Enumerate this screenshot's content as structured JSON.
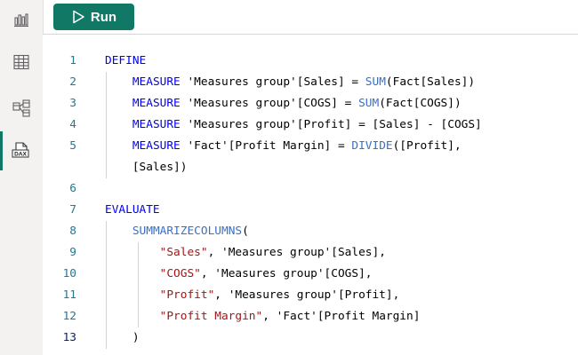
{
  "toolbar": {
    "run_label": "Run"
  },
  "sidebar": {
    "items": [
      {
        "name": "report-view",
        "icon": "bar-chart-icon",
        "active": false
      },
      {
        "name": "table-view",
        "icon": "table-icon",
        "active": false
      },
      {
        "name": "model-view",
        "icon": "model-icon",
        "active": false
      },
      {
        "name": "dax-query-view",
        "icon": "dax-icon",
        "icon_text": "DAX",
        "active": true
      }
    ]
  },
  "colors": {
    "accent": "#117865",
    "keyword": "#0000ff",
    "function": "#3a6fc4",
    "string": "#a31515",
    "line_number": "#237893",
    "sidebar_bg": "#f3f2f1"
  },
  "editor": {
    "current_line": "13",
    "lines": [
      {
        "num": "1",
        "tokens": [
          {
            "t": "DEFINE",
            "c": "kw"
          }
        ]
      },
      {
        "num": "2",
        "tokens": [
          {
            "t": "    ",
            "c": "op"
          },
          {
            "t": "MEASURE",
            "c": "kw"
          },
          {
            "t": " 'Measures group'[Sales] = ",
            "c": "op"
          },
          {
            "t": "SUM",
            "c": "fn"
          },
          {
            "t": "(Fact[Sales])",
            "c": "op"
          }
        ]
      },
      {
        "num": "3",
        "tokens": [
          {
            "t": "    ",
            "c": "op"
          },
          {
            "t": "MEASURE",
            "c": "kw"
          },
          {
            "t": " 'Measures group'[COGS] = ",
            "c": "op"
          },
          {
            "t": "SUM",
            "c": "fn"
          },
          {
            "t": "(Fact[COGS])",
            "c": "op"
          }
        ]
      },
      {
        "num": "4",
        "tokens": [
          {
            "t": "    ",
            "c": "op"
          },
          {
            "t": "MEASURE",
            "c": "kw"
          },
          {
            "t": " 'Measures group'[Profit] = [Sales] - [COGS]",
            "c": "op"
          }
        ]
      },
      {
        "num": "5",
        "tokens": [
          {
            "t": "    ",
            "c": "op"
          },
          {
            "t": "MEASURE",
            "c": "kw"
          },
          {
            "t": " 'Fact'[Profit Margin] = ",
            "c": "op"
          },
          {
            "t": "DIVIDE",
            "c": "fn"
          },
          {
            "t": "([Profit],",
            "c": "op"
          }
        ]
      },
      {
        "num": "",
        "tokens": [
          {
            "t": "    [Sales])",
            "c": "op"
          }
        ]
      },
      {
        "num": "6",
        "tokens": []
      },
      {
        "num": "7",
        "tokens": [
          {
            "t": "EVALUATE",
            "c": "kw"
          }
        ]
      },
      {
        "num": "8",
        "tokens": [
          {
            "t": "    ",
            "c": "op"
          },
          {
            "t": "SUMMARIZECOLUMNS",
            "c": "fn"
          },
          {
            "t": "(",
            "c": "op"
          }
        ]
      },
      {
        "num": "9",
        "tokens": [
          {
            "t": "        ",
            "c": "op"
          },
          {
            "t": "\"Sales\"",
            "c": "str"
          },
          {
            "t": ", 'Measures group'[Sales],",
            "c": "op"
          }
        ]
      },
      {
        "num": "10",
        "tokens": [
          {
            "t": "        ",
            "c": "op"
          },
          {
            "t": "\"COGS\"",
            "c": "str"
          },
          {
            "t": ", 'Measures group'[COGS],",
            "c": "op"
          }
        ]
      },
      {
        "num": "11",
        "tokens": [
          {
            "t": "        ",
            "c": "op"
          },
          {
            "t": "\"Profit\"",
            "c": "str"
          },
          {
            "t": ", 'Measures group'[Profit],",
            "c": "op"
          }
        ]
      },
      {
        "num": "12",
        "tokens": [
          {
            "t": "        ",
            "c": "op"
          },
          {
            "t": "\"Profit Margin\"",
            "c": "str"
          },
          {
            "t": ", 'Fact'[Profit Margin]",
            "c": "op"
          }
        ]
      },
      {
        "num": "13",
        "tokens": [
          {
            "t": "    )",
            "c": "op"
          }
        ]
      }
    ]
  }
}
